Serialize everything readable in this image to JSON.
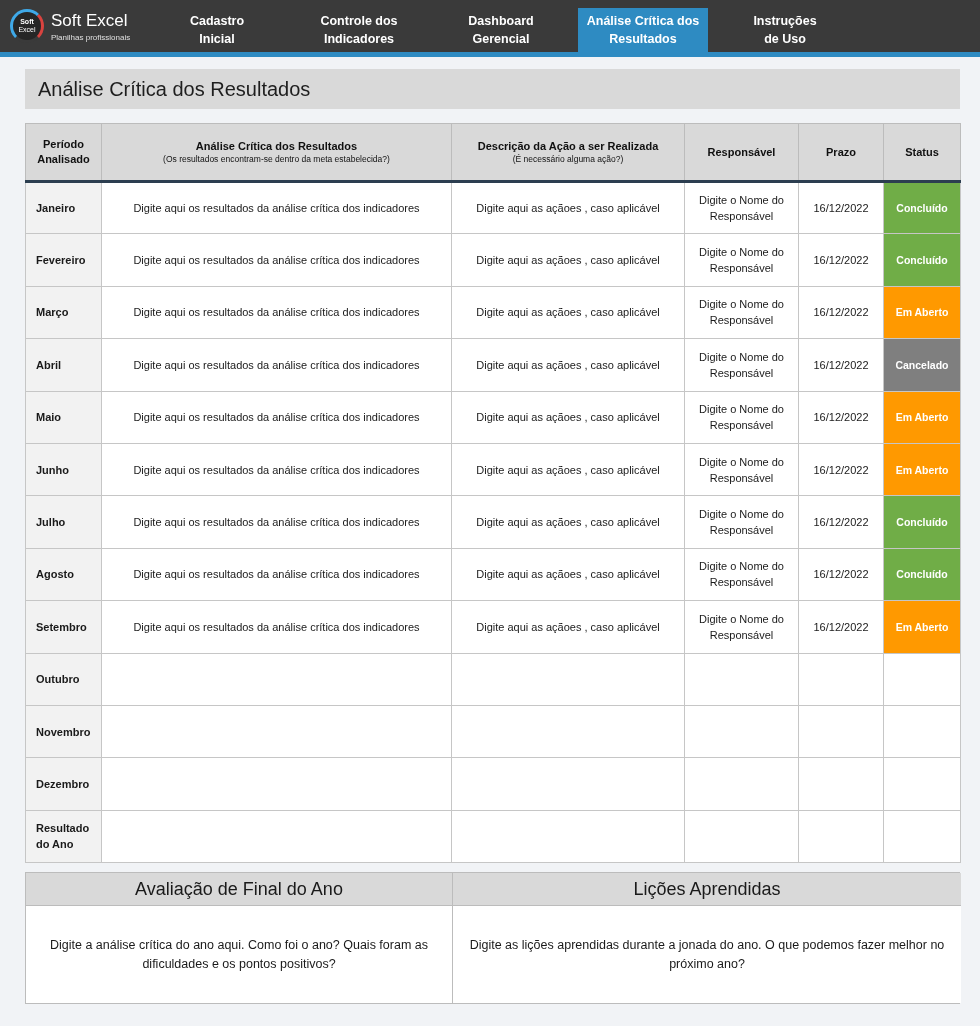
{
  "header": {
    "logo": {
      "badge": [
        "Soft",
        "Excel"
      ],
      "name": "**Soft** Excel",
      "tagline": "Planilhas profissionais"
    },
    "tabs": [
      {
        "lines": [
          "Cadastro",
          "Inicial"
        ],
        "selected": false
      },
      {
        "lines": [
          "Controle dos",
          "Indicadores"
        ],
        "selected": false
      },
      {
        "lines": [
          "Dashboard",
          "Gerencial"
        ],
        "selected": false
      },
      {
        "lines": [
          "Análise Crítica dos",
          "Resultados"
        ],
        "selected": true
      },
      {
        "lines": [
          "Instruções",
          "de Uso"
        ],
        "selected": false
      }
    ]
  },
  "page_title": "Análise Crítica dos Resultados",
  "table": {
    "columns": [
      {
        "title": "Período Analisado"
      },
      {
        "title": "Análise Crítica dos Resultados",
        "subtitle": "(Os resultados encontram-se dentro da meta estabelecida?)"
      },
      {
        "title": "Descrição da Ação a ser Realizada",
        "subtitle": "(É necessário alguma ação?)"
      },
      {
        "title": "Responsável"
      },
      {
        "title": "Prazo"
      },
      {
        "title": "Status"
      }
    ],
    "rows": [
      {
        "period": "Janeiro",
        "analysis": "Digite aqui os resultados da análise crítica dos indicadores",
        "action": "Digite aqui as açãoes , caso aplicável",
        "responsible": "Digite o Nome do Responsável",
        "deadline": "16/12/2022",
        "status": {
          "label": "Concluído",
          "color": "#70ad47"
        }
      },
      {
        "period": "Fevereiro",
        "analysis": "Digite aqui os resultados da análise crítica dos indicadores",
        "action": "Digite aqui as açãoes , caso aplicável",
        "responsible": "Digite o Nome do Responsável",
        "deadline": "16/12/2022",
        "status": {
          "label": "Concluído",
          "color": "#70ad47"
        }
      },
      {
        "period": "Março",
        "analysis": "Digite aqui os resultados da análise crítica dos indicadores",
        "action": "Digite aqui as açãoes , caso aplicável",
        "responsible": "Digite o Nome do Responsável",
        "deadline": "16/12/2022",
        "status": {
          "label": "Em Aberto",
          "color": "#ff9900"
        }
      },
      {
        "period": "Abril",
        "analysis": "Digite aqui os resultados da análise crítica dos indicadores",
        "action": "Digite aqui as açãoes , caso aplicável",
        "responsible": "Digite o Nome do Responsável",
        "deadline": "16/12/2022",
        "status": {
          "label": "Cancelado",
          "color": "#7f7f7f"
        }
      },
      {
        "period": "Maio",
        "analysis": "Digite aqui os resultados da análise crítica dos indicadores",
        "action": "Digite aqui as açãoes , caso aplicável",
        "responsible": "Digite o Nome do Responsável",
        "deadline": "16/12/2022",
        "status": {
          "label": "Em Aberto",
          "color": "#ff9900"
        }
      },
      {
        "period": "Junho",
        "analysis": "Digite aqui os resultados da análise crítica dos indicadores",
        "action": "Digite aqui as açãoes , caso aplicável",
        "responsible": "Digite o Nome do Responsável",
        "deadline": "16/12/2022",
        "status": {
          "label": "Em Aberto",
          "color": "#ff9900"
        }
      },
      {
        "period": "Julho",
        "analysis": "Digite aqui os resultados da análise crítica dos indicadores",
        "action": "Digite aqui as açãoes , caso aplicável",
        "responsible": "Digite o Nome do Responsável",
        "deadline": "16/12/2022",
        "status": {
          "label": "Concluído",
          "color": "#70ad47"
        }
      },
      {
        "period": "Agosto",
        "analysis": "Digite aqui os resultados da análise crítica dos indicadores",
        "action": "Digite aqui as açãoes , caso aplicável",
        "responsible": "Digite o Nome do Responsável",
        "deadline": "16/12/2022",
        "status": {
          "label": "Concluído",
          "color": "#70ad47"
        }
      },
      {
        "period": "Setembro",
        "analysis": "Digite aqui os resultados da análise crítica dos indicadores",
        "action": "Digite aqui as açãoes , caso aplicável",
        "responsible": "Digite o Nome do Responsável",
        "deadline": "16/12/2022",
        "status": {
          "label": "Em Aberto",
          "color": "#ff9900"
        }
      },
      {
        "period": "Outubro"
      },
      {
        "period": "Novembro"
      },
      {
        "period": "Dezembro"
      },
      {
        "period": "Resultado do Ano"
      }
    ]
  },
  "year_review": [
    {
      "title": "Avaliação de Final do Ano",
      "text": "Digite a análise crítica do ano aqui. Como foi o ano? Quais foram as dificuldades e os pontos positivos?"
    },
    {
      "title": "Lições Aprendidas",
      "text": "Digite as lições aprendidas durante a jonada do ano. O que podemos fazer melhor no próximo ano?"
    }
  ]
}
